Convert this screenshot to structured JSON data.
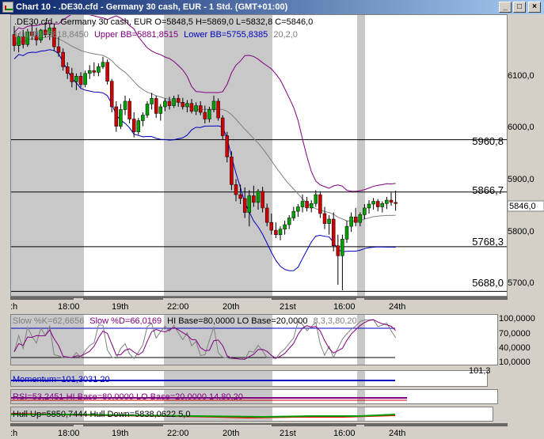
{
  "window": {
    "title": "Chart 10 - .DE30.cfd - Germany 30 cash, EUR - 1 Std. (GMT+01:00)",
    "buttons": [
      "_",
      "□",
      "×"
    ]
  },
  "main_panel": {
    "header": ".DE30.cfd - Germany 30 cash, EUR O=5848,5 H=5869,0 L=5832,8 C=5846,0",
    "bb_header_mid": "Mid BB=5818,8450",
    "bb_header_upper": "Upper BB=5881,8515",
    "bb_header_lower": "Lower BB=5755,8385",
    "bb_header_params": "20,2,0",
    "price_ticks": [
      "6100,0",
      "6000,0",
      "5900,0",
      "5800,0",
      "5700,0"
    ],
    "hlines": [
      "5960,8",
      "5866,7",
      "5768,3",
      "5688,0"
    ],
    "current_price": "5846,0"
  },
  "time_axis": {
    "labels": [
      ":h",
      "18:00",
      "19th",
      "22:00",
      "20th",
      "21st",
      "16:00",
      "24th"
    ]
  },
  "stoch_panel": {
    "header_slow_k": "Slow %K=62,6656",
    "header_slow_d": "Slow %D=66,0169",
    "header_levels": "HI Base=80,0000 LO Base=20,0000",
    "header_params": "8,3,3,80,20",
    "ticks": [
      "100,0000",
      "70,0000",
      "40,0000",
      "10,0000"
    ]
  },
  "momentum_panel": {
    "header": "Momentum=101,3031  20",
    "right_value": "101,3"
  },
  "rsi_panel": {
    "header": "RSI=53,2451 HI Base=80,0000 LO Base=20,0000  14,80,20"
  },
  "hull_panel": {
    "header": "Hull Up=5850,7444 Hull Down=5838,0622  5,0"
  },
  "colors": {
    "candle_up": "#00a000",
    "candle_down": "#d00000",
    "bb_upper": "#800080",
    "bb_lower": "#0000c0",
    "bb_mid": "#808080",
    "session_shade": "#c0c0c0",
    "stoch_k": "#808080",
    "stoch_d": "#800080",
    "hull_up": "#00a000",
    "hull_down": "#ff0000"
  },
  "chart_data": {
    "type": "candlestick",
    "title": ".DE30.cfd - Germany 30 cash, EUR",
    "ylim": [
      5680,
      6185
    ],
    "ohlc": [
      [
        6150,
        6165,
        6120,
        6130
      ],
      [
        6130,
        6152,
        6118,
        6146
      ],
      [
        6146,
        6158,
        6125,
        6132
      ],
      [
        6132,
        6160,
        6128,
        6155
      ],
      [
        6155,
        6170,
        6140,
        6148
      ],
      [
        6148,
        6162,
        6130,
        6140
      ],
      [
        6140,
        6160,
        6135,
        6158
      ],
      [
        6158,
        6172,
        6145,
        6150
      ],
      [
        6150,
        6168,
        6140,
        6162
      ],
      [
        6162,
        6170,
        6120,
        6128
      ],
      [
        6128,
        6145,
        6110,
        6118
      ],
      [
        6118,
        6125,
        6085,
        6092
      ],
      [
        6092,
        6100,
        6070,
        6080
      ],
      [
        6080,
        6090,
        6055,
        6065
      ],
      [
        6065,
        6080,
        6050,
        6075
      ],
      [
        6075,
        6082,
        6055,
        6060
      ],
      [
        6060,
        6085,
        6055,
        6080
      ],
      [
        6080,
        6095,
        6070,
        6085
      ],
      [
        6085,
        6100,
        6075,
        6082
      ],
      [
        6082,
        6098,
        6075,
        6092
      ],
      [
        6092,
        6110,
        6088,
        6100
      ],
      [
        6100,
        6105,
        6060,
        6066
      ],
      [
        6066,
        6070,
        6010,
        6020
      ],
      [
        6020,
        6030,
        5975,
        5985
      ],
      [
        5985,
        6025,
        5980,
        6015
      ],
      [
        6015,
        6040,
        6005,
        6030
      ],
      [
        6030,
        6035,
        5990,
        5998
      ],
      [
        5998,
        6010,
        5965,
        5975
      ],
      [
        5975,
        6000,
        5970,
        5995
      ],
      [
        5995,
        6010,
        5985,
        6005
      ],
      [
        6005,
        6030,
        6000,
        6025
      ],
      [
        6025,
        6045,
        6015,
        6035
      ],
      [
        6035,
        6040,
        6000,
        6008
      ],
      [
        6008,
        6025,
        5995,
        6020
      ],
      [
        6020,
        6035,
        6012,
        6030
      ],
      [
        6030,
        6038,
        6015,
        6022
      ],
      [
        6022,
        6040,
        6018,
        6035
      ],
      [
        6035,
        6042,
        6020,
        6028
      ],
      [
        6028,
        6036,
        6015,
        6020
      ],
      [
        6020,
        6032,
        6010,
        6026
      ],
      [
        6026,
        6034,
        6008,
        6012
      ],
      [
        6012,
        6028,
        6005,
        6022
      ],
      [
        6022,
        6030,
        6005,
        6010
      ],
      [
        6010,
        6022,
        5990,
        5998
      ],
      [
        5998,
        6020,
        5992,
        6015
      ],
      [
        6015,
        6040,
        6010,
        6030
      ],
      [
        6030,
        6035,
        5995,
        6000
      ],
      [
        6000,
        6005,
        5960,
        5968
      ],
      [
        5968,
        5975,
        5920,
        5930
      ],
      [
        5930,
        5940,
        5870,
        5880
      ],
      [
        5880,
        5890,
        5850,
        5862
      ],
      [
        5862,
        5880,
        5845,
        5855
      ],
      [
        5855,
        5875,
        5820,
        5830
      ],
      [
        5830,
        5870,
        5805,
        5860
      ],
      [
        5860,
        5878,
        5840,
        5848
      ],
      [
        5848,
        5872,
        5835,
        5868
      ],
      [
        5868,
        5876,
        5830,
        5838
      ],
      [
        5838,
        5846,
        5805,
        5812
      ],
      [
        5812,
        5828,
        5790,
        5798
      ],
      [
        5798,
        5812,
        5784,
        5790
      ],
      [
        5790,
        5805,
        5780,
        5800
      ],
      [
        5800,
        5815,
        5790,
        5808
      ],
      [
        5808,
        5825,
        5800,
        5820
      ],
      [
        5820,
        5840,
        5815,
        5832
      ],
      [
        5832,
        5845,
        5822,
        5840
      ],
      [
        5840,
        5862,
        5830,
        5850
      ],
      [
        5850,
        5858,
        5832,
        5838
      ],
      [
        5838,
        5852,
        5830,
        5846
      ],
      [
        5846,
        5870,
        5840,
        5862
      ],
      [
        5862,
        5868,
        5820,
        5828
      ],
      [
        5828,
        5840,
        5800,
        5810
      ],
      [
        5810,
        5825,
        5790,
        5818
      ],
      [
        5818,
        5830,
        5760,
        5770
      ],
      [
        5770,
        5790,
        5700,
        5752
      ],
      [
        5752,
        5790,
        5690,
        5782
      ],
      [
        5782,
        5815,
        5775,
        5805
      ],
      [
        5805,
        5830,
        5795,
        5822
      ],
      [
        5822,
        5838,
        5805,
        5812
      ],
      [
        5812,
        5830,
        5805,
        5826
      ],
      [
        5826,
        5845,
        5818,
        5838
      ],
      [
        5838,
        5852,
        5828,
        5845
      ],
      [
        5845,
        5856,
        5835,
        5850
      ],
      [
        5850,
        5854,
        5832,
        5840
      ],
      [
        5840,
        5850,
        5830,
        5846
      ],
      [
        5846,
        5858,
        5836,
        5852
      ],
      [
        5852,
        5866,
        5842,
        5848
      ],
      [
        5848,
        5869,
        5833,
        5846
      ]
    ]
  }
}
